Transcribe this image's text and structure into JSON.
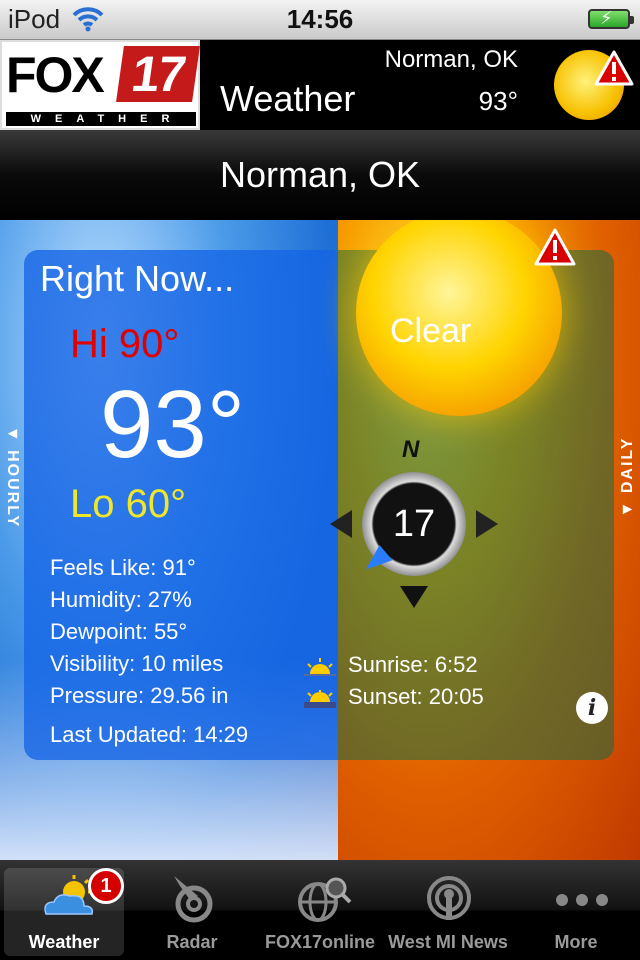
{
  "status_bar": {
    "carrier": "iPod",
    "time": "14:56"
  },
  "header": {
    "logo": {
      "brand": "FOX",
      "number": "17",
      "subtitle": "WEATHER"
    },
    "title": "Weather",
    "location": "Norman, OK",
    "temperature": "93°"
  },
  "location_bar": {
    "label": "Norman, OK"
  },
  "right_now": {
    "title": "Right Now...",
    "hi": "Hi 90°",
    "temp": "93°",
    "lo": "Lo 60°",
    "details": [
      "Feels Like: 91°",
      "Humidity: 27%",
      "Dewpoint: 55°",
      "Visibility: 10 miles",
      "Pressure: 29.56 in"
    ],
    "last_updated": "Last Updated: 14:29"
  },
  "conditions": {
    "label": "Clear",
    "wind_dir_label": "N",
    "wind_speed": "17",
    "sunrise": "Sunrise: 6:52",
    "sunset": "Sunset: 20:05",
    "info_glyph": "i"
  },
  "side_tabs": {
    "left": "▼ HOURLY",
    "right": "▼ DAILY"
  },
  "tabs": [
    {
      "label": "Weather",
      "icon": "partly-cloudy-icon",
      "badge": "1",
      "active": true
    },
    {
      "label": "Radar",
      "icon": "radar-icon"
    },
    {
      "label": "FOX17online",
      "icon": "globe-search-icon"
    },
    {
      "label": "West MI News",
      "icon": "podcast-icon"
    },
    {
      "label": "More",
      "icon": "more-dots-icon"
    }
  ],
  "colors": {
    "hi": "#e00000",
    "lo": "#f0e62a",
    "badge": "#d40000",
    "brand_red": "#c41a1a"
  }
}
